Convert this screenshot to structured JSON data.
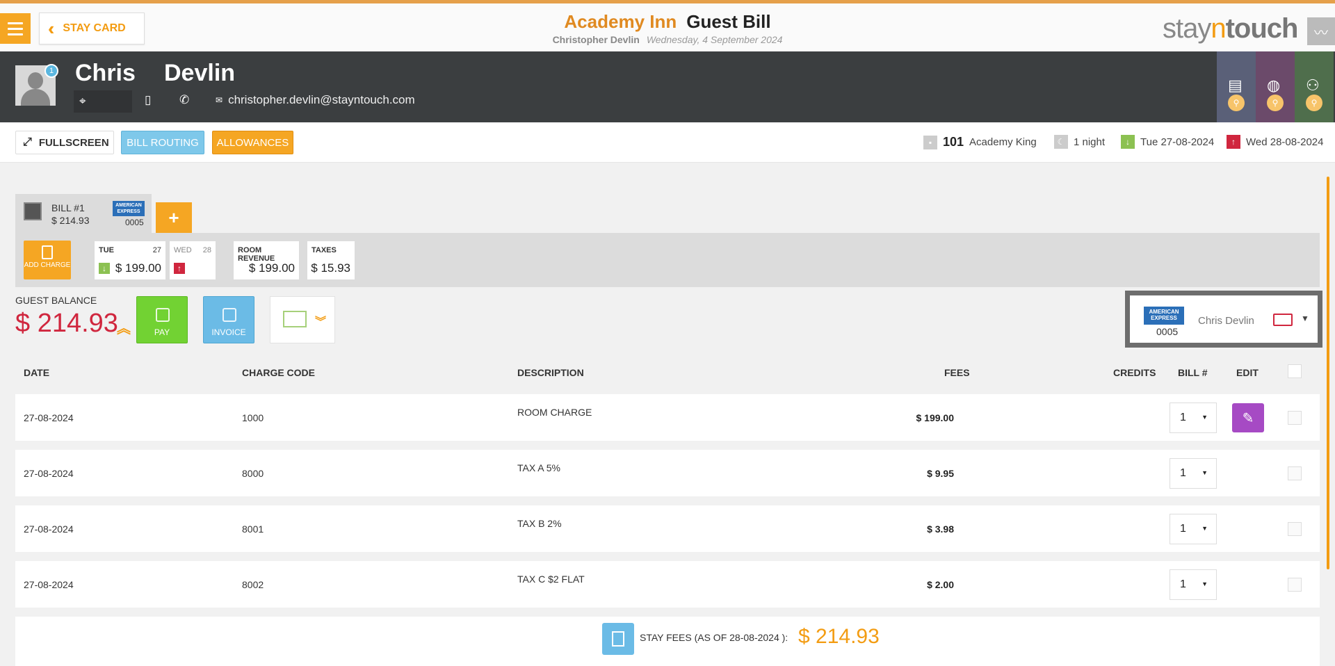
{
  "header": {
    "menu_icon": "hamburger-icon",
    "stay_card_label": "STAY CARD",
    "hotel_name": "Academy Inn",
    "page_title": "Guest Bill",
    "guest_name": "Christopher Devlin",
    "date": "Wednesday, 4 September 2024",
    "brand_pre": "stay",
    "brand_n": "n",
    "brand_post": "touch",
    "accent_color": "#f5a623"
  },
  "guest": {
    "first_name": "Chris",
    "last_name": "Devlin",
    "badge_count": "1",
    "email": "christopher.devlin@stayntouch.com"
  },
  "toolbar": {
    "fullscreen_label": "FULLSCREEN",
    "bill_routing_label": "BILL ROUTING",
    "allowances_label": "ALLOWANCES",
    "room_number": "101",
    "room_type": "Academy King",
    "nights": "1 night",
    "arrival": "Tue 27-08-2024",
    "departure": "Wed 28-08-2024"
  },
  "bill": {
    "name": "BILL #1",
    "amount": "$ 214.93",
    "card_brand": "AMERICAN EXPRESS",
    "card_last4": "0005",
    "add_bill_label": "+"
  },
  "summary": {
    "add_charge_label": "ADD CHARGE",
    "days": [
      {
        "day": "TUE",
        "num": "27",
        "amount": "$ 199.00"
      },
      {
        "day": "WED",
        "num": "28",
        "amount": ""
      }
    ],
    "room_revenue_label": "ROOM REVENUE",
    "room_revenue": "$ 199.00",
    "taxes_label": "TAXES",
    "taxes": "$ 15.93"
  },
  "balance": {
    "label": "GUEST BALANCE",
    "amount": "$ 214.93",
    "pay_label": "PAY",
    "invoice_label": "INVOICE"
  },
  "payment_card": {
    "brand": "AMERICAN EXPRESS",
    "last4": "0005",
    "holder": "Chris Devlin"
  },
  "table": {
    "headers": {
      "date": "DATE",
      "charge_code": "CHARGE CODE",
      "description": "DESCRIPTION",
      "fees": "FEES",
      "credits": "CREDITS",
      "bill_no": "BILL #",
      "edit": "EDIT"
    },
    "rows": [
      {
        "date": "27-08-2024",
        "code": "1000",
        "description": "ROOM CHARGE",
        "fees": "$ 199.00",
        "credits": "",
        "bill": "1"
      },
      {
        "date": "27-08-2024",
        "code": "8000",
        "description": "TAX A 5%",
        "fees": "$ 9.95",
        "credits": "",
        "bill": "1"
      },
      {
        "date": "27-08-2024",
        "code": "8001",
        "description": "TAX B 2%",
        "fees": "$ 3.98",
        "credits": "",
        "bill": "1"
      },
      {
        "date": "27-08-2024",
        "code": "8002",
        "description": "TAX C $2 FLAT",
        "fees": "$ 2.00",
        "credits": "",
        "bill": "1"
      }
    ]
  },
  "footer": {
    "label": "STAY FEES (AS OF  28-08-2024 ):",
    "amount": "$ 214.93"
  }
}
